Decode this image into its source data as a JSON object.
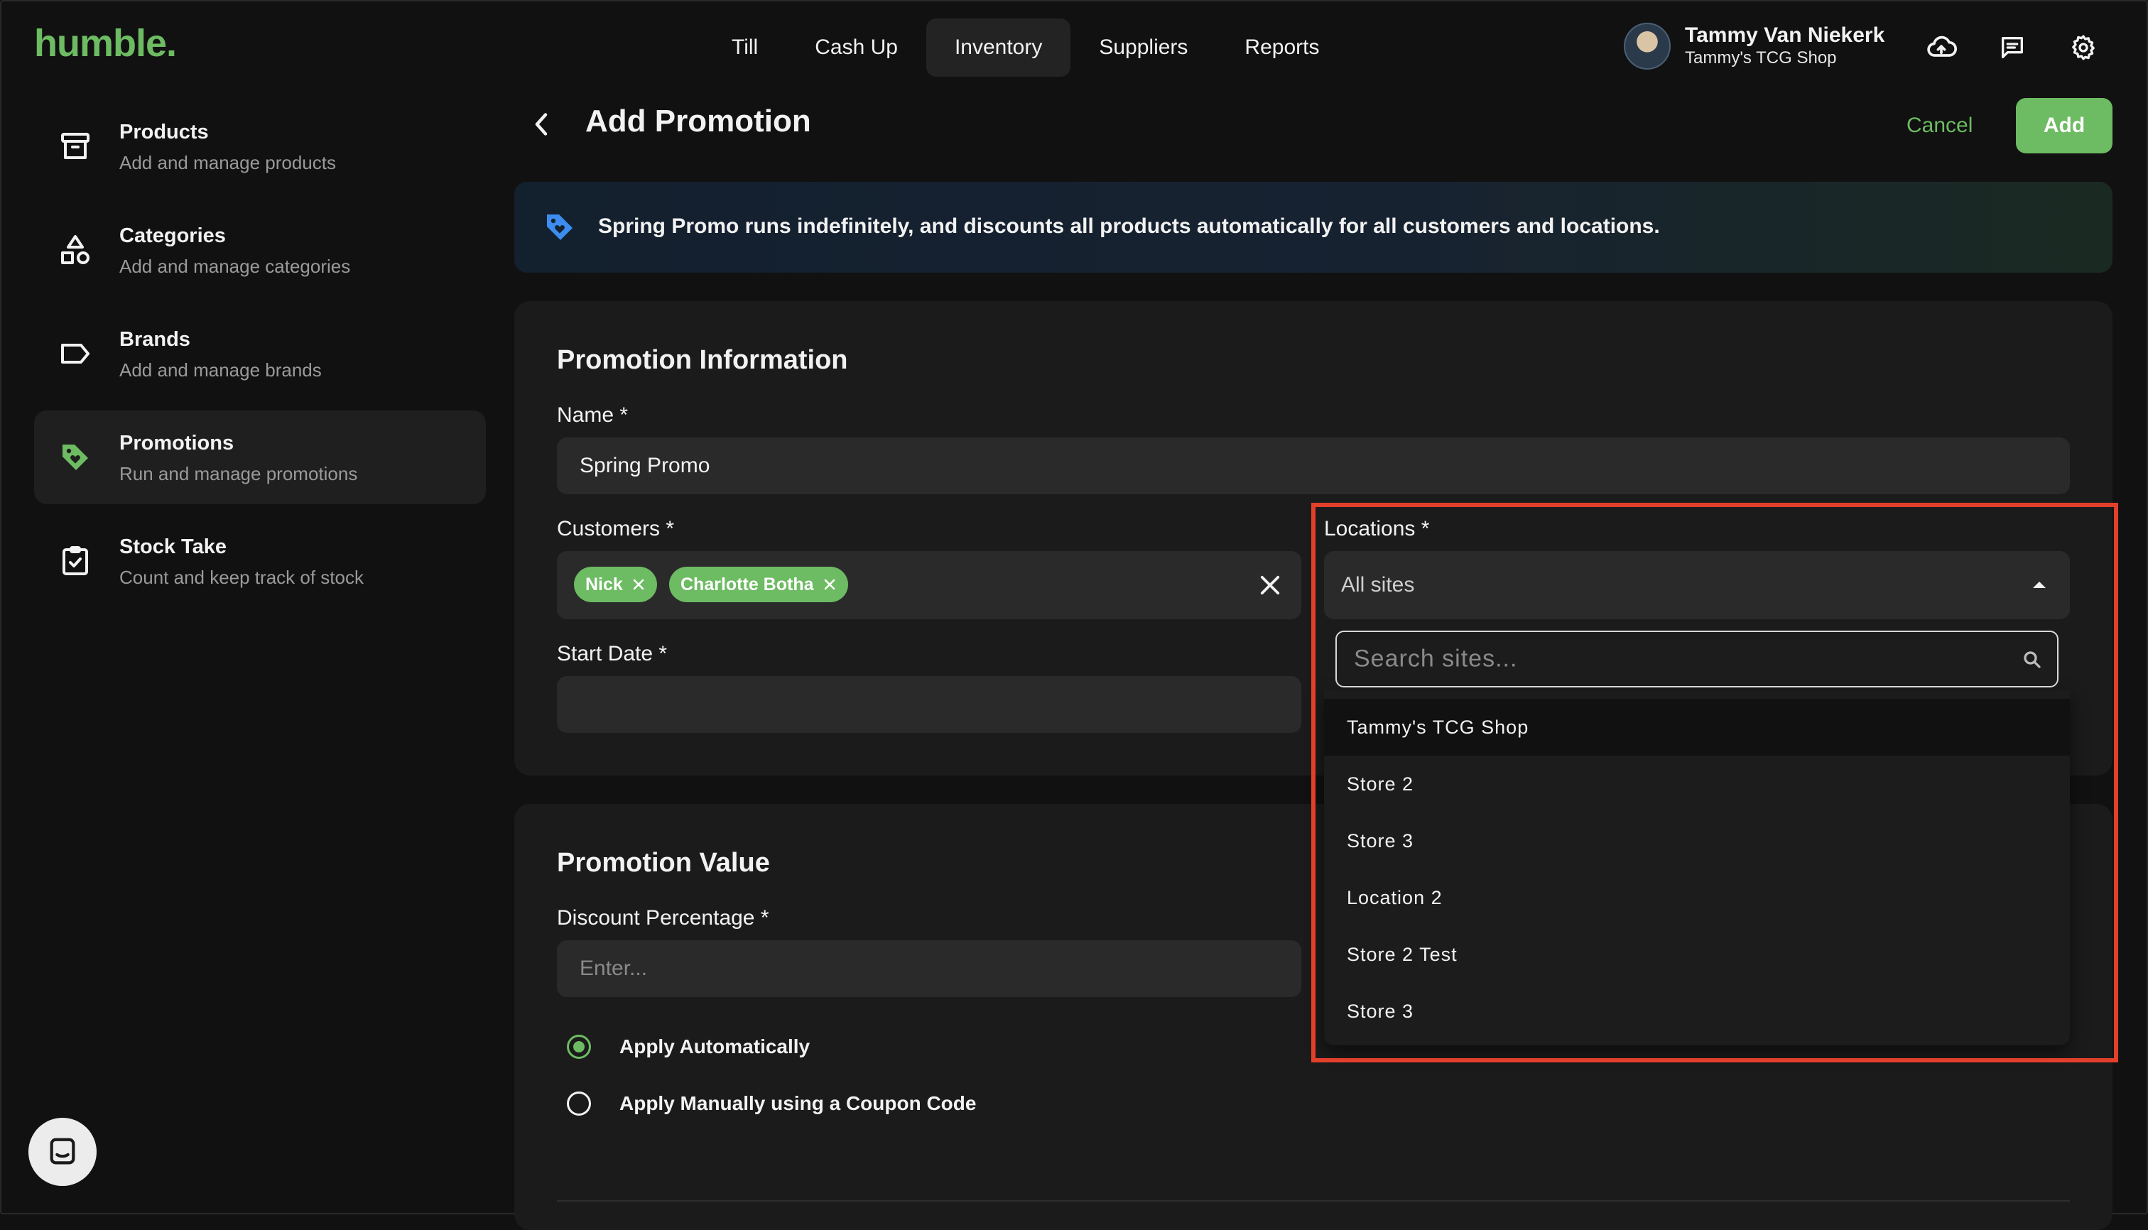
{
  "app": {
    "logo": "humble."
  },
  "topnav": [
    {
      "label": "Till",
      "active": false
    },
    {
      "label": "Cash Up",
      "active": false
    },
    {
      "label": "Inventory",
      "active": true
    },
    {
      "label": "Suppliers",
      "active": false
    },
    {
      "label": "Reports",
      "active": false
    }
  ],
  "user": {
    "name": "Tammy Van Niekerk",
    "shop": "Tammy's TCG Shop"
  },
  "top_icons": [
    "cloud-upload-icon",
    "message-icon",
    "settings-gear-icon"
  ],
  "sidebar": {
    "items": [
      {
        "title": "Products",
        "subtitle": "Add and manage products",
        "icon": "archive-box-icon"
      },
      {
        "title": "Categories",
        "subtitle": "Add and manage categories",
        "icon": "shapes-icon"
      },
      {
        "title": "Brands",
        "subtitle": "Add and manage brands",
        "icon": "label-tag-icon"
      },
      {
        "title": "Promotions",
        "subtitle": "Run and manage promotions",
        "icon": "promo-tag-icon"
      },
      {
        "title": "Stock Take",
        "subtitle": "Count and keep track of stock",
        "icon": "clipboard-check-icon"
      }
    ],
    "active": "Promotions"
  },
  "header": {
    "title": "Add Promotion",
    "cancel_label": "Cancel",
    "add_label": "Add"
  },
  "banner": {
    "text": "Spring Promo runs indefinitely, and discounts all products automatically for all customers and locations."
  },
  "promotion_info": {
    "title": "Promotion Information",
    "name_label": "Name *",
    "name_value": "Spring Promo",
    "customers_label": "Customers *",
    "customers": [
      "Nick",
      "Charlotte Botha"
    ],
    "locations_label": "Locations *",
    "locations_value": "All sites",
    "start_date_label": "Start Date *",
    "start_date_value": ""
  },
  "locations_dropdown": {
    "search_placeholder": "Search sites...",
    "options": [
      "Tammy's TCG Shop",
      "Store 2",
      "Store 3",
      "Location 2",
      "Store 2 Test",
      "Store 3"
    ],
    "highlighted_index": 0
  },
  "promotion_value": {
    "title": "Promotion Value",
    "discount_label": "Discount Percentage *",
    "discount_placeholder": "Enter...",
    "apply_options": [
      {
        "label": "Apply Automatically",
        "selected": true
      },
      {
        "label": "Apply Manually using a Coupon Code",
        "selected": false
      }
    ]
  },
  "colors": {
    "accent": "#6dbb62",
    "background": "#111111",
    "card": "#1b1b1b",
    "annotation": "#e2402a"
  }
}
